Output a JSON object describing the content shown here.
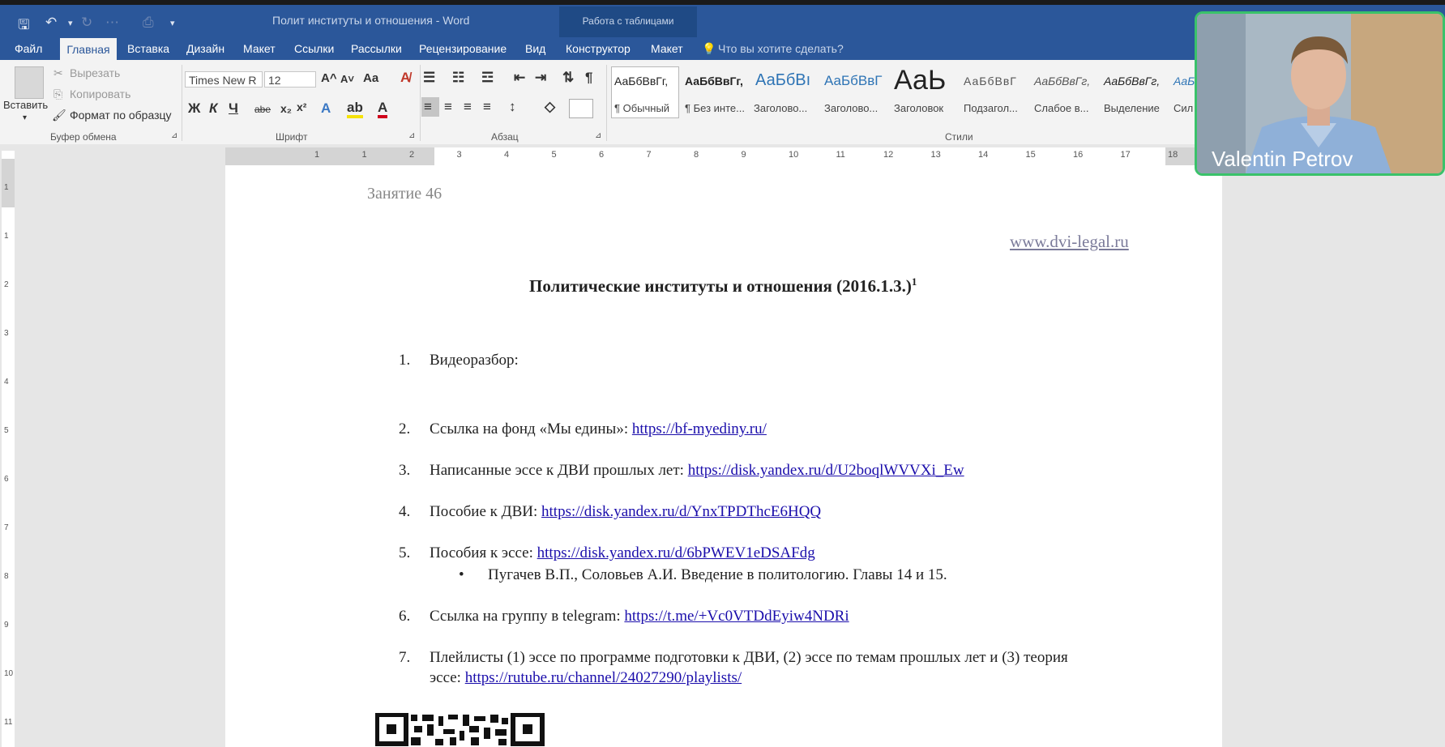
{
  "window": {
    "title": "Полит институты и отношения - Word",
    "table_tools": "Работа с таблицами"
  },
  "menu": {
    "items": [
      "Файл",
      "Главная",
      "Вставка",
      "Дизайн",
      "Макет",
      "Ссылки",
      "Рассылки",
      "Рецензирование",
      "Вид",
      "Конструктор",
      "Макет"
    ],
    "active": "Главная",
    "tell_me": "Что вы хотите сделать?"
  },
  "ribbon": {
    "clipboard": {
      "paste": "Вставить",
      "cut": "Вырезать",
      "copy": "Копировать",
      "format_painter": "Формат по образцу",
      "group": "Буфер обмена"
    },
    "font": {
      "name": "Times New R",
      "size": "12",
      "group": "Шрифт",
      "bold": "Ж",
      "italic": "К",
      "underline": "Ч",
      "strike": "abe",
      "case": "Aa"
    },
    "paragraph": {
      "group": "Абзац"
    },
    "styles": {
      "group": "Стили",
      "items": [
        {
          "preview": "АаБбВвГг,",
          "name": "¶ Обычный"
        },
        {
          "preview": "АаБбВвГг,",
          "name": "¶ Без инте..."
        },
        {
          "preview": "АаБбВı",
          "name": "Заголово..."
        },
        {
          "preview": "АаБбВвГ",
          "name": "Заголово..."
        },
        {
          "preview": "АаЬ",
          "name": "Заголовок"
        },
        {
          "preview": "АаБбВвГ",
          "name": "Подзагол..."
        },
        {
          "preview": "АаБбВвГг,",
          "name": "Слабое в..."
        },
        {
          "preview": "АаБбВвГг,",
          "name": "Выделение"
        },
        {
          "preview": "АаБ",
          "name": "Сил"
        }
      ]
    }
  },
  "ruler": {
    "numbers": [
      "1",
      "1",
      "2",
      "3",
      "4",
      "5",
      "6",
      "7",
      "8",
      "9",
      "10",
      "11",
      "12",
      "13",
      "14",
      "15",
      "16",
      "17",
      "18"
    ],
    "vnumbers": [
      "1",
      "1",
      "2",
      "3",
      "4",
      "5",
      "6",
      "7",
      "8",
      "9",
      "10",
      "11"
    ]
  },
  "document": {
    "lesson": "Занятие 46",
    "site": "www.dvi-legal.ru",
    "heading": "Политические институты и отношения (2016.1.3.)",
    "heading_sup": "1",
    "items": [
      {
        "num": "1.",
        "text": "Видеоразбор:",
        "link": ""
      },
      {
        "num": "2.",
        "text": "Ссылка на фонд «Мы едины»: ",
        "link": "https://bf-myediny.ru/"
      },
      {
        "num": "3.",
        "text": "Написанные эссе к ДВИ прошлых лет: ",
        "link": "https://disk.yandex.ru/d/U2boqlWVVXi_Ew"
      },
      {
        "num": "4.",
        "text": "Пособие к ДВИ: ",
        "link": "https://disk.yandex.ru/d/YnxTPDThcE6HQQ"
      },
      {
        "num": "5.",
        "text": "Пособия к эссе: ",
        "link": "https://disk.yandex.ru/d/6bPWEV1eDSAFdg"
      },
      {
        "num": "6.",
        "text": "Ссылка на группу в telegram: ",
        "link": "https://t.me/+Vc0VTDdEyiw4NDRi"
      },
      {
        "num": "7.",
        "text": "Плейлисты (1) эссе по программе подготовки к ДВИ, (2) эссе по темам прошлых лет и (3) теория",
        "link": ""
      }
    ],
    "bullet": "Пугачев В.П., Соловьев А.И. Введение в политологию. Главы 14 и 15.",
    "item7_cont": "эссе: ",
    "item7_link": "https://rutube.ru/channel/24027290/playlists/"
  },
  "video": {
    "name": "Valentin Petrov"
  }
}
